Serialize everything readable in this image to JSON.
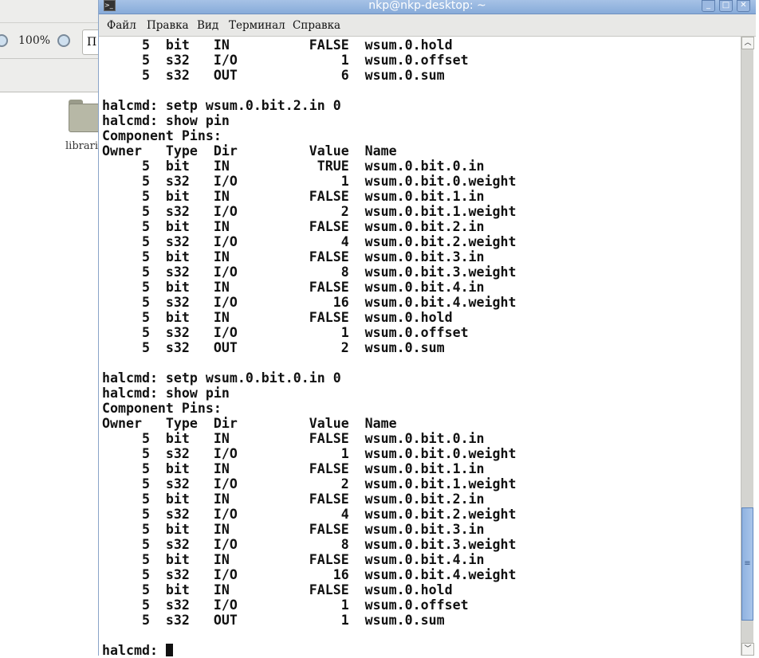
{
  "background_window": {
    "zoom_level": "100%",
    "path_button": "П",
    "folder_label": "librarie"
  },
  "window": {
    "title": "nkp@nkp-desktop: ~",
    "menu": [
      "Файл",
      "Правка",
      "Вид",
      "Терминал",
      "Справка"
    ],
    "scroll_position": 0.95
  },
  "terminal": {
    "lines": [
      "     5  bit   IN          FALSE  wsum.0.hold",
      "     5  s32   I/O             1  wsum.0.offset",
      "     5  s32   OUT             6  wsum.0.sum",
      "",
      "halcmd: setp wsum.0.bit.2.in 0",
      "halcmd: show pin",
      "Component Pins:",
      "Owner   Type  Dir         Value  Name",
      "     5  bit   IN           TRUE  wsum.0.bit.0.in",
      "     5  s32   I/O             1  wsum.0.bit.0.weight",
      "     5  bit   IN          FALSE  wsum.0.bit.1.in",
      "     5  s32   I/O             2  wsum.0.bit.1.weight",
      "     5  bit   IN          FALSE  wsum.0.bit.2.in",
      "     5  s32   I/O             4  wsum.0.bit.2.weight",
      "     5  bit   IN          FALSE  wsum.0.bit.3.in",
      "     5  s32   I/O             8  wsum.0.bit.3.weight",
      "     5  bit   IN          FALSE  wsum.0.bit.4.in",
      "     5  s32   I/O            16  wsum.0.bit.4.weight",
      "     5  bit   IN          FALSE  wsum.0.hold",
      "     5  s32   I/O             1  wsum.0.offset",
      "     5  s32   OUT             2  wsum.0.sum",
      "",
      "halcmd: setp wsum.0.bit.0.in 0",
      "halcmd: show pin",
      "Component Pins:",
      "Owner   Type  Dir         Value  Name",
      "     5  bit   IN          FALSE  wsum.0.bit.0.in",
      "     5  s32   I/O             1  wsum.0.bit.0.weight",
      "     5  bit   IN          FALSE  wsum.0.bit.1.in",
      "     5  s32   I/O             2  wsum.0.bit.1.weight",
      "     5  bit   IN          FALSE  wsum.0.bit.2.in",
      "     5  s32   I/O             4  wsum.0.bit.2.weight",
      "     5  bit   IN          FALSE  wsum.0.bit.3.in",
      "     5  s32   I/O             8  wsum.0.bit.3.weight",
      "     5  bit   IN          FALSE  wsum.0.bit.4.in",
      "     5  s32   I/O            16  wsum.0.bit.4.weight",
      "     5  bit   IN          FALSE  wsum.0.hold",
      "     5  s32   I/O             1  wsum.0.offset",
      "     5  s32   OUT             1  wsum.0.sum",
      ""
    ],
    "prompt": "halcmd: "
  }
}
